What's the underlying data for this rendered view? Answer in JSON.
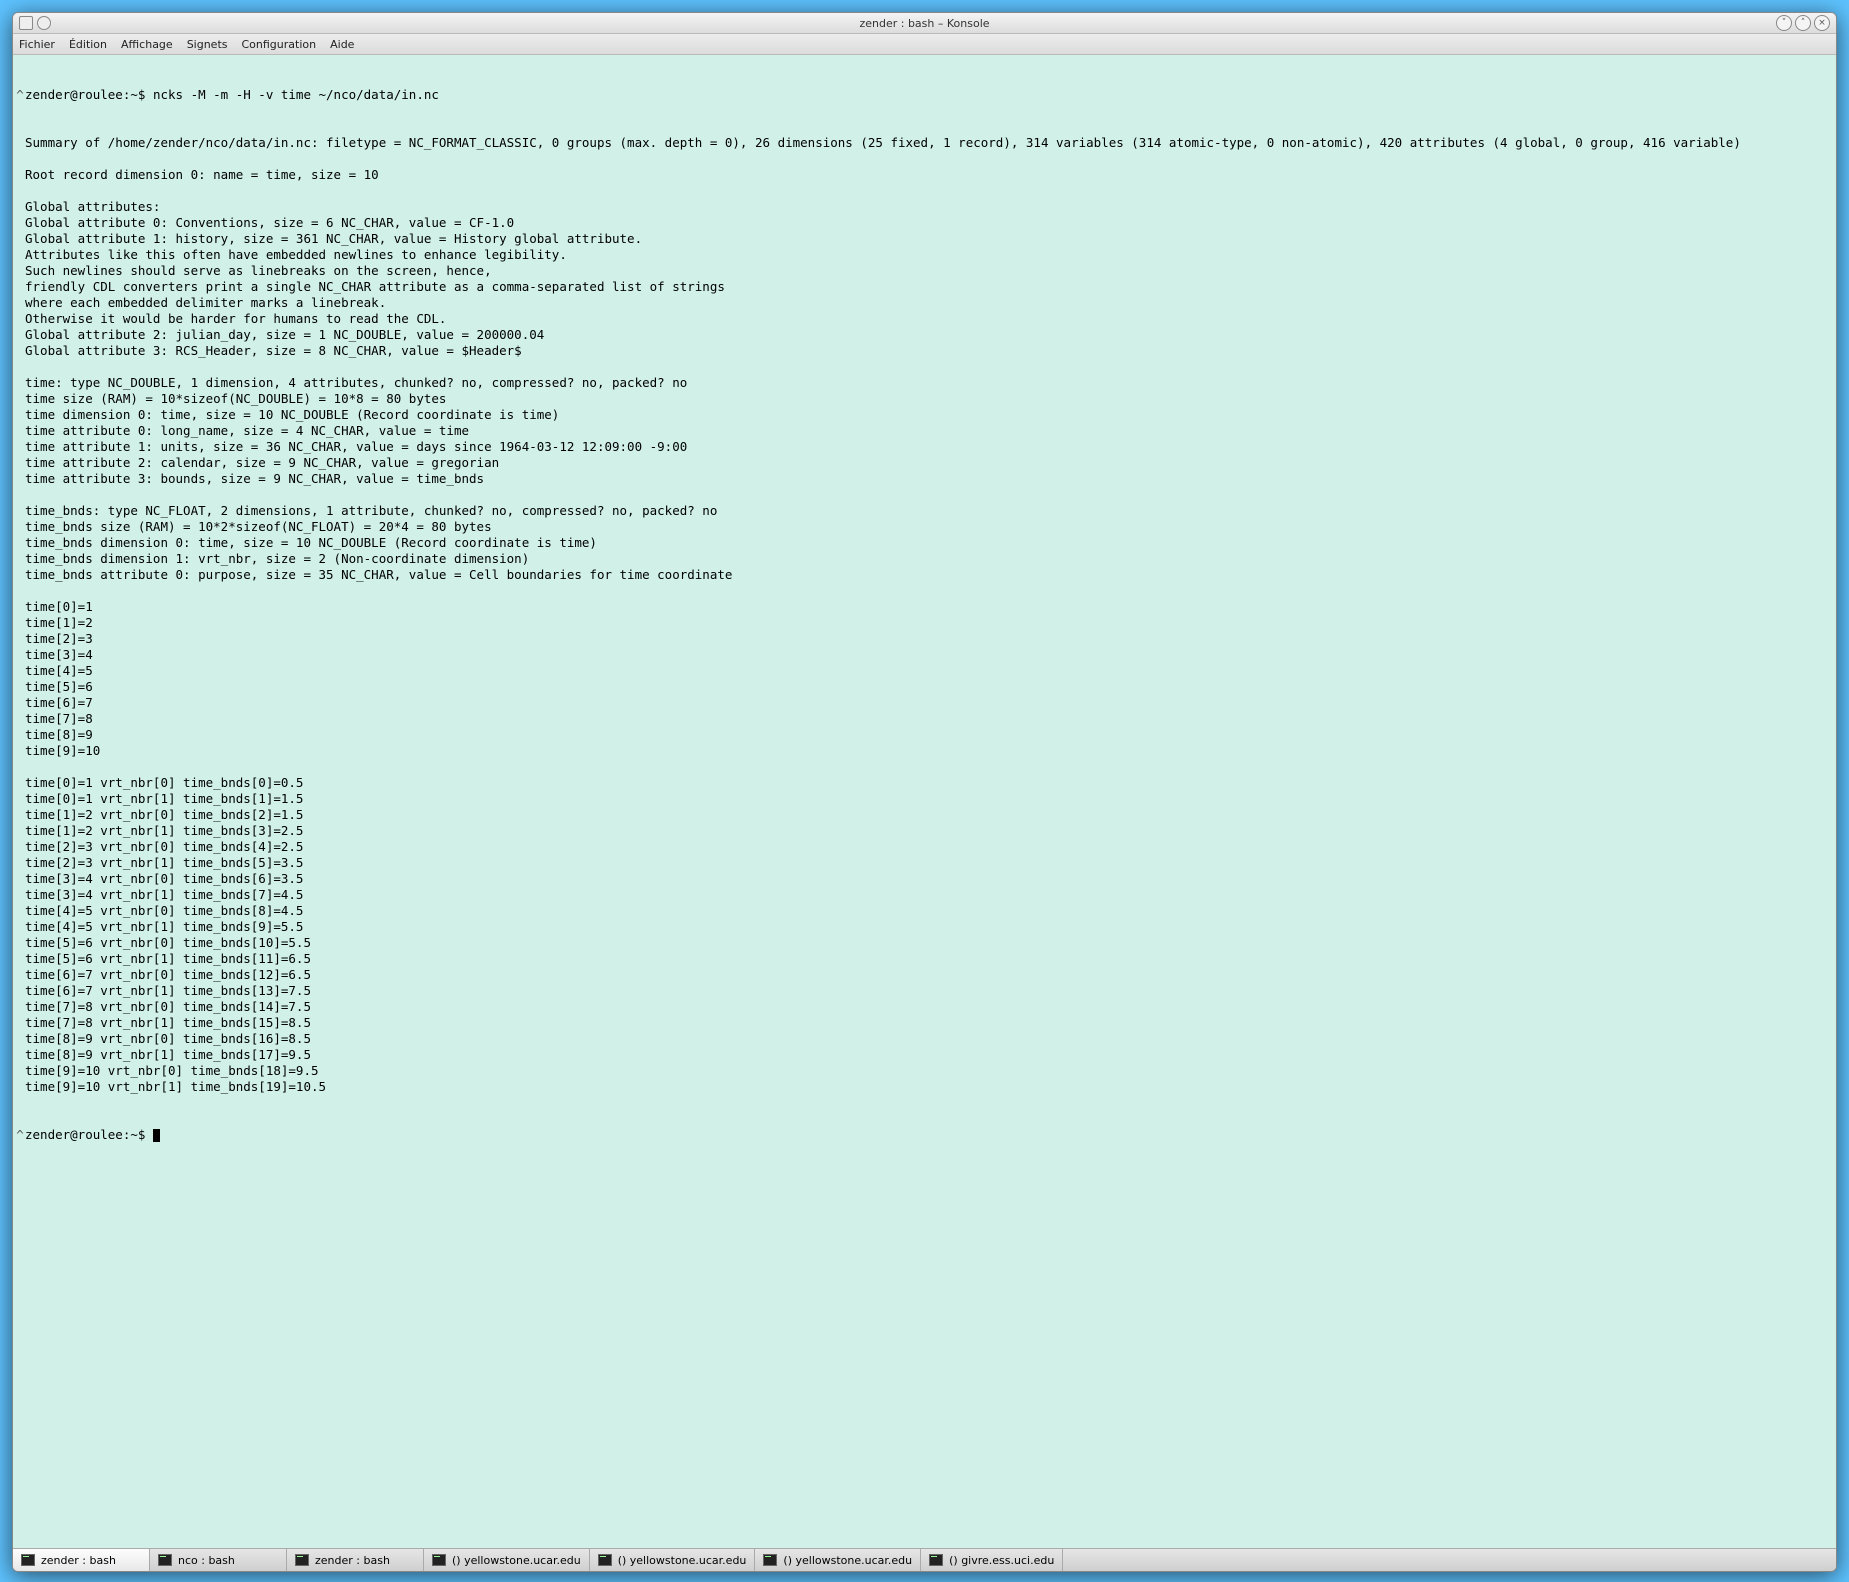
{
  "window": {
    "title": "zender : bash – Konsole"
  },
  "menubar": {
    "items": [
      "Fichier",
      "Édition",
      "Affichage",
      "Signets",
      "Configuration",
      "Aide"
    ]
  },
  "prompt1_gutter": "^",
  "prompt1_prompt": "zender@roulee:~$ ",
  "prompt1_cmd": "ncks -M -m -H -v time ~/nco/data/in.nc",
  "output_lines": [
    "Summary of /home/zender/nco/data/in.nc: filetype = NC_FORMAT_CLASSIC, 0 groups (max. depth = 0), 26 dimensions (25 fixed, 1 record), 314 variables (314 atomic-type, 0 non-atomic), 420 attributes (4 global, 0 group, 416 variable)",
    "",
    "Root record dimension 0: name = time, size = 10",
    "",
    "Global attributes:",
    "Global attribute 0: Conventions, size = 6 NC_CHAR, value = CF-1.0",
    "Global attribute 1: history, size = 361 NC_CHAR, value = History global attribute.",
    "Attributes like this often have embedded newlines to enhance legibility.",
    "Such newlines should serve as linebreaks on the screen, hence,",
    "friendly CDL converters print a single NC_CHAR attribute as a comma-separated list of strings",
    "where each embedded delimiter marks a linebreak.",
    "Otherwise it would be harder for humans to read the CDL.",
    "Global attribute 2: julian_day, size = 1 NC_DOUBLE, value = 200000.04",
    "Global attribute 3: RCS_Header, size = 8 NC_CHAR, value = $Header$",
    "",
    "time: type NC_DOUBLE, 1 dimension, 4 attributes, chunked? no, compressed? no, packed? no",
    "time size (RAM) = 10*sizeof(NC_DOUBLE) = 10*8 = 80 bytes",
    "time dimension 0: time, size = 10 NC_DOUBLE (Record coordinate is time)",
    "time attribute 0: long_name, size = 4 NC_CHAR, value = time",
    "time attribute 1: units, size = 36 NC_CHAR, value = days since 1964-03-12 12:09:00 -9:00",
    "time attribute 2: calendar, size = 9 NC_CHAR, value = gregorian",
    "time attribute 3: bounds, size = 9 NC_CHAR, value = time_bnds",
    "",
    "time_bnds: type NC_FLOAT, 2 dimensions, 1 attribute, chunked? no, compressed? no, packed? no",
    "time_bnds size (RAM) = 10*2*sizeof(NC_FLOAT) = 20*4 = 80 bytes",
    "time_bnds dimension 0: time, size = 10 NC_DOUBLE (Record coordinate is time)",
    "time_bnds dimension 1: vrt_nbr, size = 2 (Non-coordinate dimension)",
    "time_bnds attribute 0: purpose, size = 35 NC_CHAR, value = Cell boundaries for time coordinate",
    "",
    "time[0]=1",
    "time[1]=2",
    "time[2]=3",
    "time[3]=4",
    "time[4]=5",
    "time[5]=6",
    "time[6]=7",
    "time[7]=8",
    "time[8]=9",
    "time[9]=10",
    "",
    "time[0]=1 vrt_nbr[0] time_bnds[0]=0.5",
    "time[0]=1 vrt_nbr[1] time_bnds[1]=1.5",
    "time[1]=2 vrt_nbr[0] time_bnds[2]=1.5",
    "time[1]=2 vrt_nbr[1] time_bnds[3]=2.5",
    "time[2]=3 vrt_nbr[0] time_bnds[4]=2.5",
    "time[2]=3 vrt_nbr[1] time_bnds[5]=3.5",
    "time[3]=4 vrt_nbr[0] time_bnds[6]=3.5",
    "time[3]=4 vrt_nbr[1] time_bnds[7]=4.5",
    "time[4]=5 vrt_nbr[0] time_bnds[8]=4.5",
    "time[4]=5 vrt_nbr[1] time_bnds[9]=5.5",
    "time[5]=6 vrt_nbr[0] time_bnds[10]=5.5",
    "time[5]=6 vrt_nbr[1] time_bnds[11]=6.5",
    "time[6]=7 vrt_nbr[0] time_bnds[12]=6.5",
    "time[6]=7 vrt_nbr[1] time_bnds[13]=7.5",
    "time[7]=8 vrt_nbr[0] time_bnds[14]=7.5",
    "time[7]=8 vrt_nbr[1] time_bnds[15]=8.5",
    "time[8]=9 vrt_nbr[0] time_bnds[16]=8.5",
    "time[8]=9 vrt_nbr[1] time_bnds[17]=9.5",
    "time[9]=10 vrt_nbr[0] time_bnds[18]=9.5",
    "time[9]=10 vrt_nbr[1] time_bnds[19]=10.5"
  ],
  "prompt2_gutter": "^",
  "prompt2_prompt": "zender@roulee:~$ ",
  "tabs": [
    {
      "label": "zender : bash",
      "active": true
    },
    {
      "label": "nco : bash",
      "active": false
    },
    {
      "label": "zender : bash",
      "active": false
    },
    {
      "label": "() yellowstone.ucar.edu",
      "active": false
    },
    {
      "label": "() yellowstone.ucar.edu",
      "active": false
    },
    {
      "label": "() yellowstone.ucar.edu",
      "active": false
    },
    {
      "label": "() givre.ess.uci.edu",
      "active": false
    }
  ],
  "win_controls": {
    "min": "˅",
    "max": "˄",
    "close": "×"
  }
}
